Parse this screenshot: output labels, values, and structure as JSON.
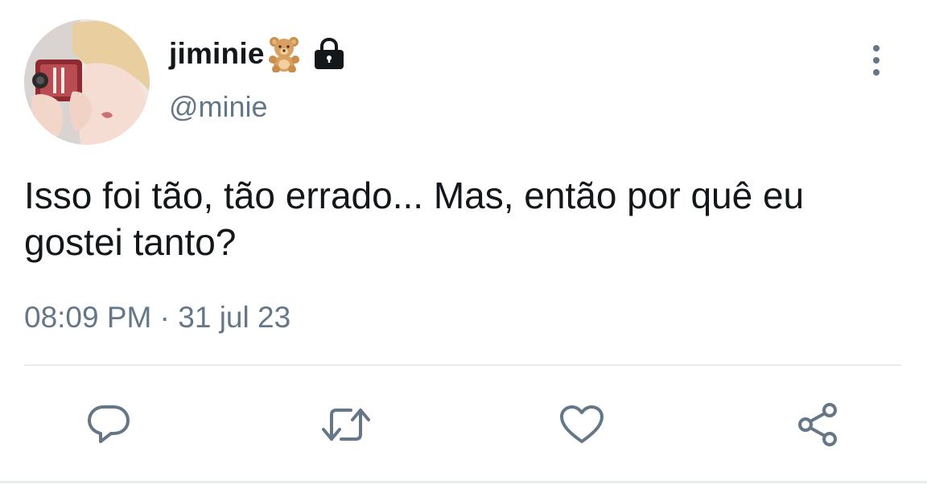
{
  "user": {
    "display_name": "jiminie",
    "handle": "@minie",
    "name_emoji": "teddy-bear-icon",
    "protected_icon": "lock-icon"
  },
  "tweet": {
    "text": "Isso foi tão, tão errado... Mas, então por quê eu gostei tanto?",
    "time": "08:09 PM",
    "separator": " · ",
    "date": "31 jul 23"
  },
  "actions": {
    "reply_icon": "reply-icon",
    "retweet_icon": "retweet-icon",
    "like_icon": "heart-icon",
    "share_icon": "share-icon",
    "more_icon": "more-vertical-icon"
  },
  "colors": {
    "text": "#14171a",
    "secondary": "#657786",
    "icon": "#657786",
    "divider": "#e6ecf0"
  }
}
